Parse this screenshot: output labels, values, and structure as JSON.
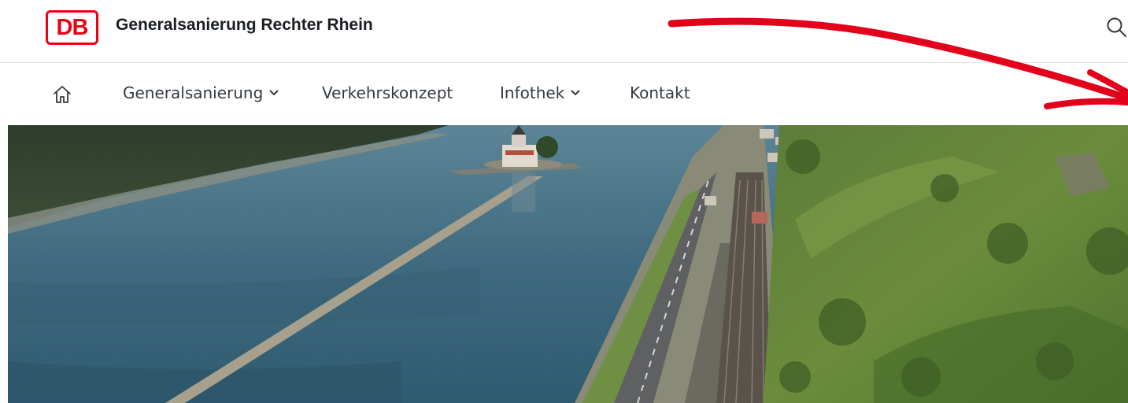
{
  "header": {
    "logo_text": "DB",
    "site_title": "Generalsanierung Rechter Rhein",
    "search_icon": "search-icon"
  },
  "nav": {
    "home_icon": "home-icon",
    "items": [
      {
        "label": "Generalsanierung",
        "has_dropdown": true
      },
      {
        "label": "Verkehrskonzept",
        "has_dropdown": false
      },
      {
        "label": "Infothek",
        "has_dropdown": true
      },
      {
        "label": "Kontakt",
        "has_dropdown": false
      }
    ]
  },
  "hero": {
    "image": "aerial-rhine-river-castle-railway"
  },
  "annotation": {
    "color": "#e3001b"
  },
  "colors": {
    "brand": "#ec0016",
    "text": "#1a1e23",
    "nav_text": "#343a40",
    "divider": "#e2e4e6"
  }
}
